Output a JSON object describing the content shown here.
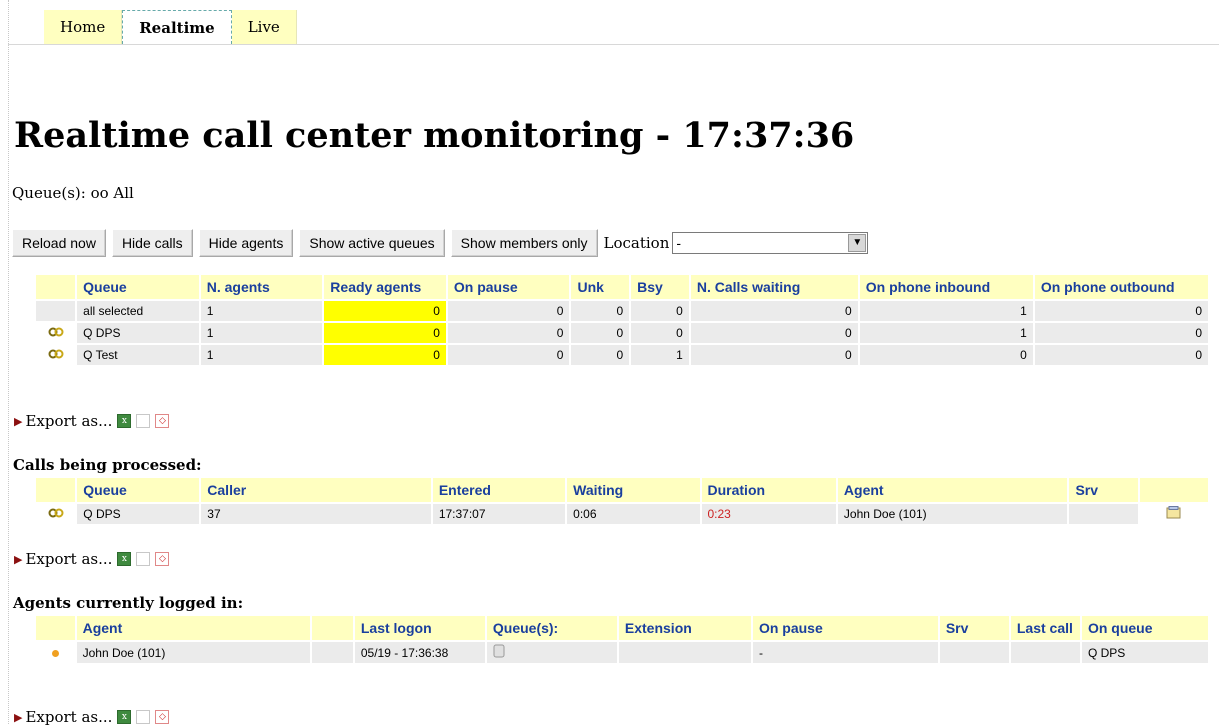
{
  "tabs": [
    {
      "label": "Home",
      "active": false
    },
    {
      "label": "Realtime",
      "active": true
    },
    {
      "label": "Live",
      "active": false
    }
  ],
  "page": {
    "title": "Realtime call center monitoring - 17:37:36",
    "queues_filter": "Queue(s): oo All"
  },
  "toolbar": {
    "reload_label": "Reload now",
    "hide_calls_label": "Hide calls",
    "hide_agents_label": "Hide agents",
    "show_active_queues_label": "Show active queues",
    "show_members_only_label": "Show members only",
    "location_label": "Location",
    "location_value": "-"
  },
  "queue_table": {
    "headers": [
      "Queue",
      "N. agents",
      "Ready agents",
      "On pause",
      "Unk",
      "Bsy",
      "N. Calls waiting",
      "On phone inbound",
      "On phone outbound"
    ],
    "rows": [
      {
        "icon": "",
        "queue": "all selected",
        "n_agents": "1",
        "ready": "0",
        "pause": "0",
        "unk": "0",
        "bsy": "0",
        "waiting": "0",
        "inbound": "1",
        "outbound": "0"
      },
      {
        "icon": "link-icon",
        "queue": "Q DPS",
        "n_agents": "1",
        "ready": "0",
        "pause": "0",
        "unk": "0",
        "bsy": "0",
        "waiting": "0",
        "inbound": "1",
        "outbound": "0"
      },
      {
        "icon": "link-icon",
        "queue": "Q Test",
        "n_agents": "1",
        "ready": "0",
        "pause": "0",
        "unk": "0",
        "bsy": "1",
        "waiting": "0",
        "inbound": "0",
        "outbound": "0"
      }
    ]
  },
  "export_label": "Export as...",
  "calls": {
    "title": "Calls being processed:",
    "headers": [
      "Queue",
      "Caller",
      "Entered",
      "Waiting",
      "Duration",
      "Agent",
      "Srv"
    ],
    "rows": [
      {
        "queue": "Q DPS",
        "caller": "37",
        "entered": "17:37:07",
        "waiting": "0:06",
        "duration": "0:23",
        "agent": "John Doe (101)",
        "srv": ""
      }
    ]
  },
  "agents": {
    "title": "Agents currently logged in:",
    "headers": [
      "Agent",
      "Last logon",
      "Queue(s):",
      "Extension",
      "On pause",
      "Srv",
      "Last call",
      "On queue"
    ],
    "rows": [
      {
        "agent": "John Doe (101)",
        "last_logon": "05/19 - 17:36:38",
        "queues": "",
        "extension": "",
        "on_pause": "-",
        "srv": "",
        "last_call": "",
        "on_queue": "Q DPS"
      }
    ]
  },
  "colors": {
    "tab_bg": "#ffffc0",
    "header_text": "#1a3f9e",
    "highlight": "#ffff00",
    "duration_red": "#cc2222"
  }
}
